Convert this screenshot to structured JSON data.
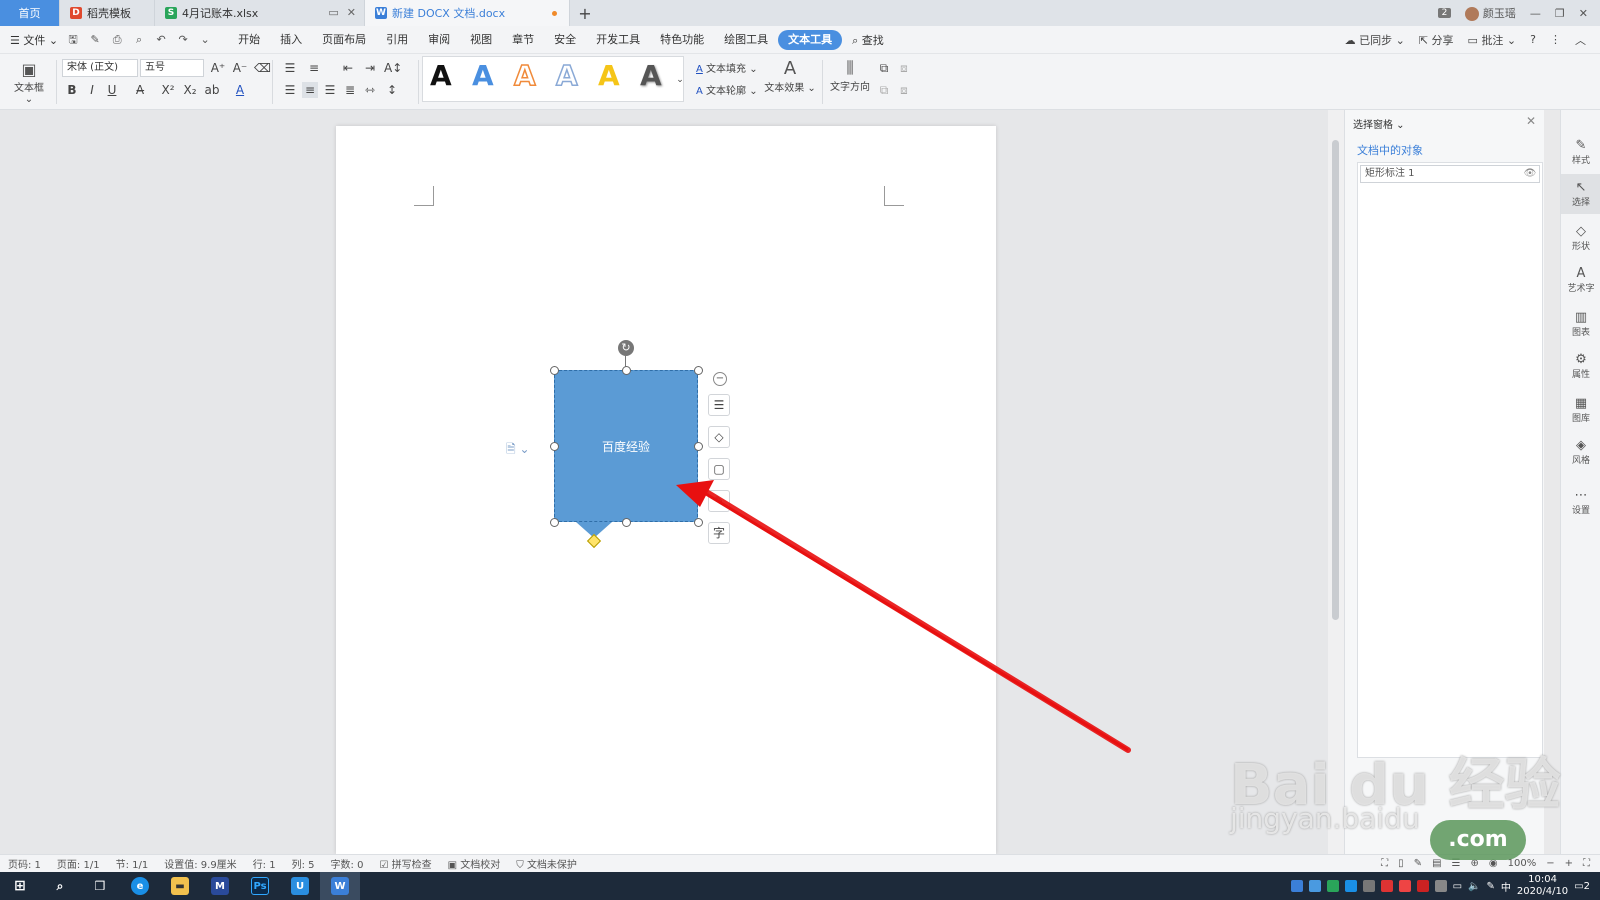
{
  "tabs": [
    {
      "label": "首页"
    },
    {
      "label": "稻壳模板"
    },
    {
      "label": "4月记账本.xlsx"
    },
    {
      "label": "新建 DOCX 文档.docx"
    }
  ],
  "titlebar": {
    "badge": "2",
    "user": "颜玉瑶"
  },
  "menu": {
    "file": "文件",
    "tabs": [
      "开始",
      "插入",
      "页面布局",
      "引用",
      "审阅",
      "视图",
      "章节",
      "安全",
      "开发工具",
      "特色功能",
      "绘图工具",
      "文本工具"
    ],
    "active_tab": "文本工具",
    "search": "查找",
    "synced": "已同步",
    "share": "分享",
    "comment": "批注"
  },
  "ribbon": {
    "textbox": "文本框",
    "font_name": "宋体 (正文)",
    "font_size": "五号",
    "text_fill": "文本填充",
    "text_outline": "文本轮廓",
    "text_effect": "文本效果",
    "text_direction": "文字方向",
    "styles": [
      {
        "letter": "A",
        "color": "#111111"
      },
      {
        "letter": "A",
        "color": "#4a8fe0"
      },
      {
        "letter": "A",
        "color": "#f08a3a"
      },
      {
        "letter": "A",
        "color": "#8aa9d6"
      },
      {
        "letter": "A",
        "color": "#f5c518"
      },
      {
        "letter": "A",
        "color": "#555555"
      }
    ]
  },
  "document": {
    "shape_text": "百度经验",
    "float_tool_char": "字"
  },
  "selection_pane": {
    "title": "选择窗格",
    "subtitle": "文档中的对象",
    "items": [
      "矩形标注 1"
    ]
  },
  "rail": [
    "样式",
    "选择",
    "形状",
    "艺术字",
    "图表",
    "属性",
    "图库",
    "风格",
    "设置"
  ],
  "status": {
    "page_num": "页码: 1",
    "pages": "页面: 1/1",
    "section": "节: 1/1",
    "setting": "设置值: 9.9厘米",
    "row": "行: 1",
    "col": "列: 5",
    "words": "字数: 0",
    "spell": "拼写检查",
    "proof": "文档校对",
    "protect": "文档未保护",
    "zoom": "100%"
  },
  "taskbar": {
    "time": "10:04",
    "date": "2020/4/10",
    "lang": "中",
    "notif": "2"
  },
  "watermark": {
    "brand": "Bai du 经验",
    "url": "jingyan.baidu",
    "dotcom": ".com"
  },
  "colors": {
    "accent": "#4a8fe0",
    "shape_fill": "#5b9bd5",
    "arrow": "#e81010"
  }
}
